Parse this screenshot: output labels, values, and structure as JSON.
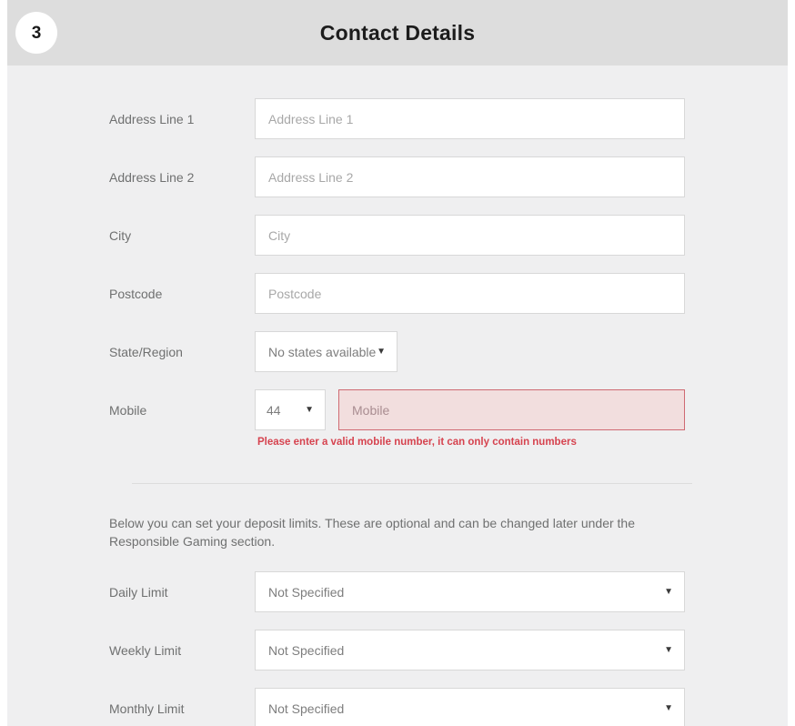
{
  "header": {
    "step_number": "3",
    "title": "Contact Details"
  },
  "colors": {
    "header_bg": "#dddddd",
    "panel_bg": "#efeff0",
    "label": "#6f7070",
    "placeholder": "#a8a8a8",
    "error_text": "#d6434f",
    "error_border": "#cf6a73",
    "error_fill": "#f2dede",
    "field_border": "#d8d8d8"
  },
  "form": {
    "fields": [
      {
        "label": "Address Line 1",
        "placeholder": "Address Line 1",
        "type": "text"
      },
      {
        "label": "Address Line 2",
        "placeholder": "Address Line 2",
        "type": "text"
      },
      {
        "label": "City",
        "placeholder": "City",
        "type": "text"
      },
      {
        "label": "Postcode",
        "placeholder": "Postcode",
        "type": "text"
      }
    ],
    "state_region": {
      "label": "State/Region",
      "value": "No states available",
      "caret": "▼"
    },
    "mobile": {
      "label": "Mobile",
      "country_code": "44",
      "caret": "▼",
      "placeholder": "Mobile",
      "error": "Please enter a valid mobile number, it can only contain numbers"
    }
  },
  "deposit": {
    "intro": "Below you can set your deposit limits. These are optional and can be changed later under the Responsible Gaming section.",
    "limits": [
      {
        "label": "Daily Limit",
        "value": "Not Specified",
        "caret": "▼"
      },
      {
        "label": "Weekly Limit",
        "value": "Not Specified",
        "caret": "▼"
      },
      {
        "label": "Monthly Limit",
        "value": "Not Specified",
        "caret": "▼"
      }
    ]
  }
}
